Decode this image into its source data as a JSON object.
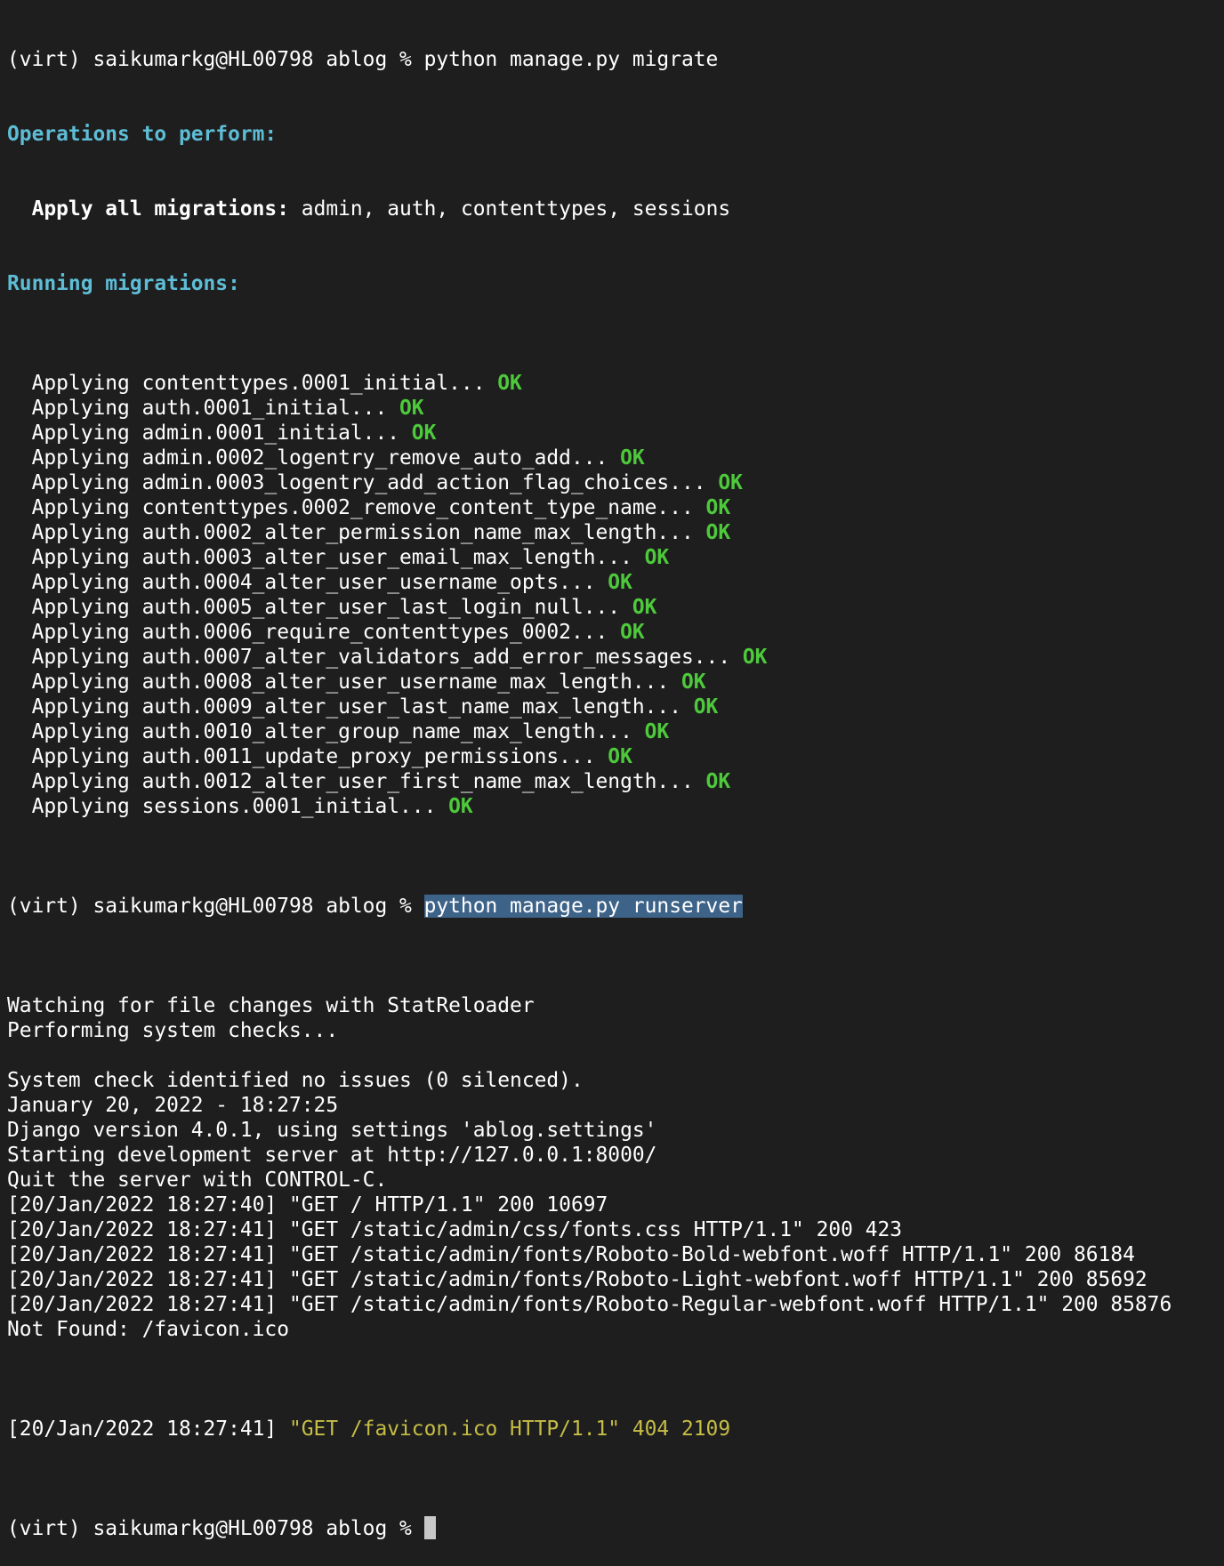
{
  "prompt": "(virt) saikumarkg@HL00798 ablog % ",
  "cmd_migrate": "python manage.py migrate",
  "ops_header": "Operations to perform:",
  "apply_all_label": "Apply all migrations:",
  "apply_all_apps": " admin, auth, contenttypes, sessions",
  "running_header": "Running migrations:",
  "ok": "OK",
  "migrations": [
    {
      "text": "  Applying contenttypes.0001_initial... "
    },
    {
      "text": "  Applying auth.0001_initial... "
    },
    {
      "text": "  Applying admin.0001_initial... "
    },
    {
      "text": "  Applying admin.0002_logentry_remove_auto_add... "
    },
    {
      "text": "  Applying admin.0003_logentry_add_action_flag_choices... "
    },
    {
      "text": "  Applying contenttypes.0002_remove_content_type_name... "
    },
    {
      "text": "  Applying auth.0002_alter_permission_name_max_length... "
    },
    {
      "text": "  Applying auth.0003_alter_user_email_max_length... "
    },
    {
      "text": "  Applying auth.0004_alter_user_username_opts... "
    },
    {
      "text": "  Applying auth.0005_alter_user_last_login_null... "
    },
    {
      "text": "  Applying auth.0006_require_contenttypes_0002... "
    },
    {
      "text": "  Applying auth.0007_alter_validators_add_error_messages... "
    },
    {
      "text": "  Applying auth.0008_alter_user_username_max_length... "
    },
    {
      "text": "  Applying auth.0009_alter_user_last_name_max_length... "
    },
    {
      "text": "  Applying auth.0010_alter_group_name_max_length... "
    },
    {
      "text": "  Applying auth.0011_update_proxy_permissions... "
    },
    {
      "text": "  Applying auth.0012_alter_user_first_name_max_length... "
    },
    {
      "text": "  Applying sessions.0001_initial... "
    }
  ],
  "cmd_runserver": "python manage.py runserver",
  "server_lines": [
    "Watching for file changes with StatReloader",
    "Performing system checks...",
    "",
    "System check identified no issues (0 silenced).",
    "January 20, 2022 - 18:27:25",
    "Django version 4.0.1, using settings 'ablog.settings'",
    "Starting development server at http://127.0.0.1:8000/",
    "Quit the server with CONTROL-C.",
    "[20/Jan/2022 18:27:40] \"GET / HTTP/1.1\" 200 10697",
    "[20/Jan/2022 18:27:41] \"GET /static/admin/css/fonts.css HTTP/1.1\" 200 423",
    "[20/Jan/2022 18:27:41] \"GET /static/admin/fonts/Roboto-Bold-webfont.woff HTTP/1.1\" 200 86184",
    "[20/Jan/2022 18:27:41] \"GET /static/admin/fonts/Roboto-Light-webfont.woff HTTP/1.1\" 200 85692",
    "[20/Jan/2022 18:27:41] \"GET /static/admin/fonts/Roboto-Regular-webfont.woff HTTP/1.1\" 200 85876",
    "Not Found: /favicon.ico"
  ],
  "favicon_prefix": "[20/Jan/2022 18:27:41] ",
  "favicon_request": "\"GET /favicon.ico HTTP/1.1\" 404 2109",
  "colors": {
    "background": "#1e1e1e",
    "foreground": "#ffffff",
    "cyan": "#5ebdd6",
    "ok_green": "#4dc93b",
    "warning_yellow": "#c6bd45",
    "selection": "#3e6389"
  }
}
